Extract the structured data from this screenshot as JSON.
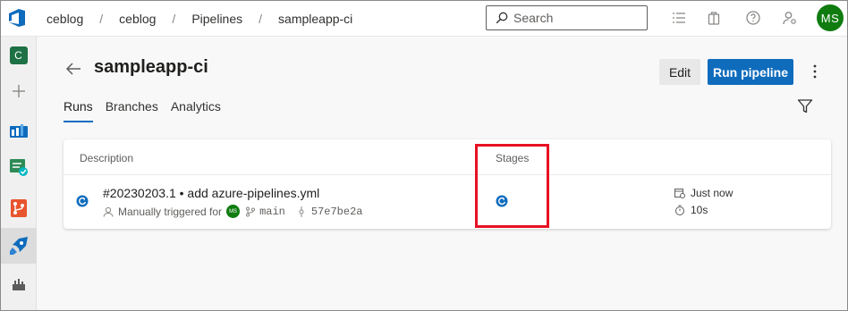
{
  "breadcrumb": [
    "ceblog",
    "ceblog",
    "Pipelines",
    "sampleapp-ci"
  ],
  "search": {
    "placeholder": "Search"
  },
  "user": {
    "initials": "MS"
  },
  "rail": {
    "project_initial": "C"
  },
  "pipeline": {
    "title": "sampleapp-ci",
    "edit_label": "Edit",
    "run_label": "Run pipeline"
  },
  "tabs": [
    "Runs",
    "Branches",
    "Analytics"
  ],
  "table": {
    "headers": {
      "description": "Description",
      "stages": "Stages"
    },
    "rows": [
      {
        "title": "#20230203.1 • add azure-pipelines.yml",
        "trigger": "Manually triggered for",
        "trigger_avatar": "MS",
        "branch": "main",
        "commit": "57e7be2a",
        "started": "Just now",
        "duration": "10s"
      }
    ]
  },
  "colors": {
    "accent": "#0f6cbd",
    "highlight": "#e81123",
    "avatar": "#107c10"
  }
}
